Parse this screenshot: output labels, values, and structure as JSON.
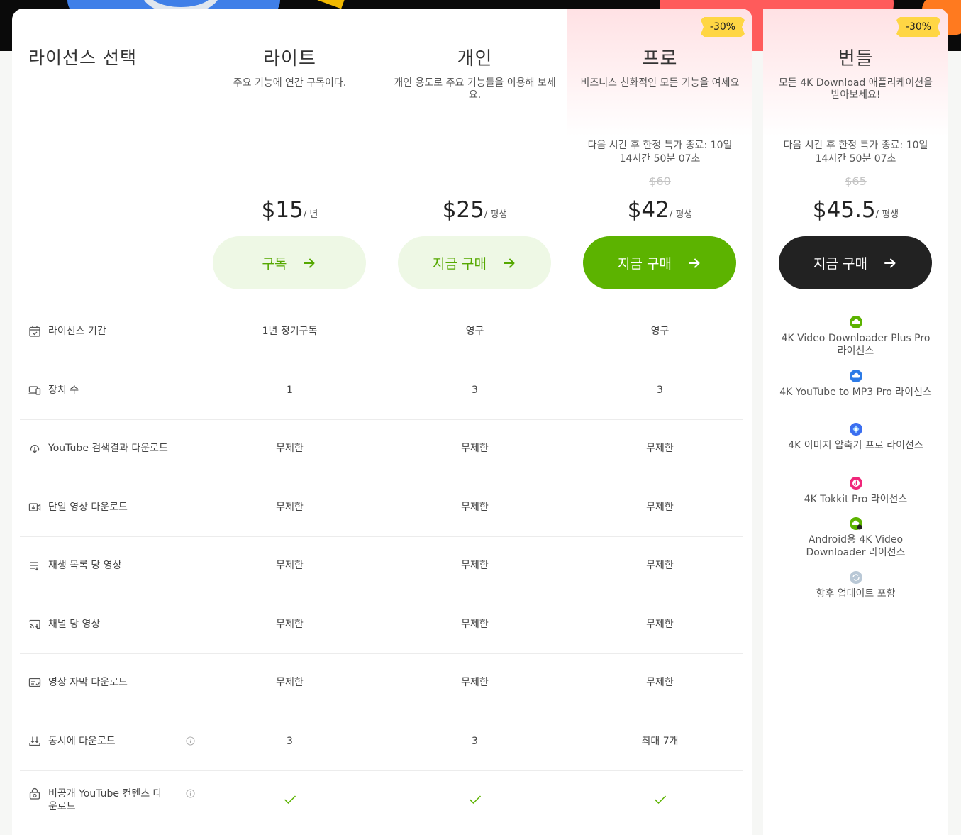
{
  "heading": "라이선스 선택",
  "plans": [
    {
      "name": "라이트",
      "description": "주요 기능에 연간 구독이다.",
      "price": "$15",
      "period": "/ 년",
      "cta": "구독"
    },
    {
      "name": "개인",
      "description": "개인 용도로 주요 기능들을 이용해 보세요.",
      "price": "$25",
      "period": "/ 평생",
      "cta": "지금 구매"
    },
    {
      "name": "프로",
      "description": "비즈니스 친화적인 모든 기능을 여세요",
      "badge": "-30%",
      "countdown": "다음 시간 후 한정 특가 종료: 10일 14시간 50분 07초",
      "old_price": "$60",
      "price": "$42",
      "period": "/ 평생",
      "cta": "지금 구매"
    },
    {
      "name": "번들",
      "description": "모든 4K Download 애플리케이션을 받아보세요!",
      "badge": "-30%",
      "countdown": "다음 시간 후 한정 특가 종료: 10일 14시간 50분 07초",
      "old_price": "$65",
      "price": "$45.5",
      "period": "/ 평생",
      "cta": "지금 구매"
    }
  ],
  "features": [
    {
      "label": "라이선스 기간",
      "icon": "calendar-icon",
      "values": [
        "1년 정기구독",
        "영구",
        "영구"
      ]
    },
    {
      "label": "장치 수",
      "icon": "devices-icon",
      "values": [
        "1",
        "3",
        "3"
      ]
    },
    {
      "label": "YouTube 검색결과 다운로드",
      "icon": "search-download-icon",
      "values": [
        "무제한",
        "무제한",
        "무제한"
      ]
    },
    {
      "label": "단일 영상 다운로드",
      "icon": "video-download-icon",
      "values": [
        "무제한",
        "무제한",
        "무제한"
      ]
    },
    {
      "label": "재생 목록 당 영상",
      "icon": "playlist-icon",
      "values": [
        "무제한",
        "무제한",
        "무제한"
      ]
    },
    {
      "label": "채널 당 영상",
      "icon": "channel-icon",
      "values": [
        "무제한",
        "무제한",
        "무제한"
      ]
    },
    {
      "label": "영상 자막 다운로드",
      "icon": "subtitles-icon",
      "values": [
        "무제한",
        "무제한",
        "무제한"
      ]
    },
    {
      "label": "동시에 다운로드",
      "icon": "simultaneous-download-icon",
      "info": true,
      "values": [
        "3",
        "3",
        "최대 7개"
      ]
    },
    {
      "label": "비공개 YouTube 컨텐츠 다운로드",
      "icon": "private-lock-icon",
      "info": true,
      "values": [
        "check",
        "check",
        "check"
      ]
    }
  ],
  "bundle_items": [
    {
      "text": "4K Video Downloader Plus Pro 라이선스",
      "icon": "video-downloader-app-icon",
      "color": "#5cb300"
    },
    {
      "text": "4K YouTube to MP3 Pro 라이선스",
      "icon": "youtube-mp3-app-icon",
      "color": "#2d7be6"
    },
    {
      "text": "4K 이미지 압축기 프로 라이선스",
      "icon": "image-compressor-app-icon",
      "color": "#3b6ef0"
    },
    {
      "text": "4K Tokkit Pro 라이선스",
      "icon": "tokkit-app-icon",
      "color": "#f0267a"
    },
    {
      "text": "Android용 4K Video Downloader 라이선스",
      "icon": "android-downloader-app-icon",
      "color": "#5cb300"
    },
    {
      "text": "향후 업데이트 포함",
      "icon": "updates-icon",
      "color": "#b9c8d6"
    }
  ],
  "colors": {
    "accent_green": "#5cb300",
    "light_green": "#eef8e5",
    "dark": "#222222",
    "badge_yellow": "#ffd644",
    "pro_tint": "#ffe1e4"
  }
}
